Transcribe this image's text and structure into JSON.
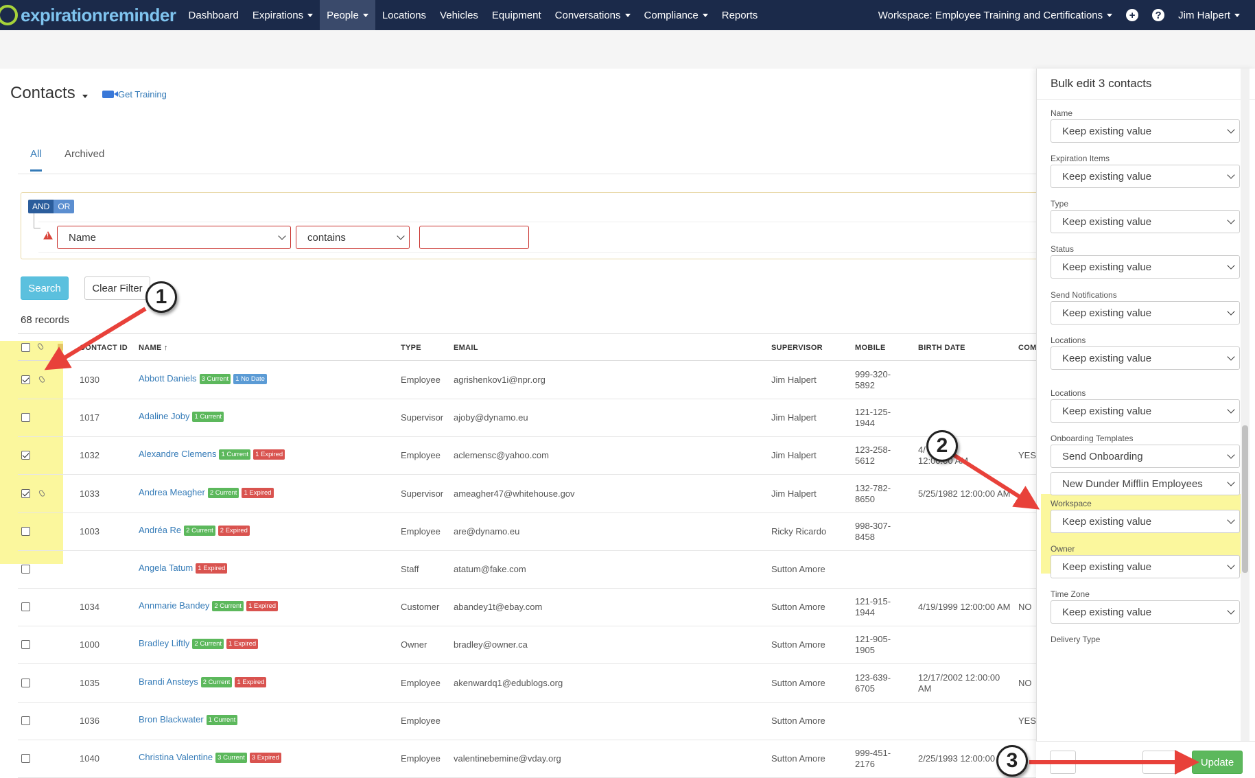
{
  "brand": {
    "name": "expirationreminder"
  },
  "nav": {
    "items": [
      {
        "label": "Dashboard",
        "dropdown": false
      },
      {
        "label": "Expirations",
        "dropdown": true
      },
      {
        "label": "People",
        "dropdown": true,
        "active": true
      },
      {
        "label": "Locations",
        "dropdown": false
      },
      {
        "label": "Vehicles",
        "dropdown": false
      },
      {
        "label": "Equipment",
        "dropdown": false
      },
      {
        "label": "Conversations",
        "dropdown": true
      },
      {
        "label": "Compliance",
        "dropdown": true
      },
      {
        "label": "Reports",
        "dropdown": false
      }
    ],
    "workspace": "Workspace: Employee Training and Certifications",
    "plus_icon": "+",
    "help_icon": "?",
    "user": "Jim Halpert"
  },
  "page": {
    "title": "Contacts",
    "training_label": "Get Training",
    "tabs": [
      "All",
      "Archived"
    ]
  },
  "filter": {
    "and_label": "AND",
    "or_label": "OR",
    "field": "Name",
    "operator": "contains",
    "value": ""
  },
  "actions": {
    "search": "Search",
    "clear": "Clear Filter"
  },
  "records": "68 records",
  "table": {
    "headers": {
      "contact_id": "CONTACT ID",
      "name": "NAME ↑",
      "type": "TYPE",
      "email": "EMAIL",
      "supervisor": "SUPERVISOR",
      "mobile": "MOBILE",
      "birth_date": "BIRTH DATE",
      "com": "COM"
    },
    "rows": [
      {
        "checked": true,
        "clip": true,
        "id": "1030",
        "name": "Abbott Daniels",
        "badges": [
          {
            "text": "3 Current",
            "kind": "current"
          },
          {
            "text": "1 No Date",
            "kind": "nodate"
          }
        ],
        "type": "Employee",
        "email": "agrishenkov1i@npr.org",
        "supervisor": "Jim Halpert",
        "mobile": [
          "999-320-",
          "5892"
        ],
        "birth": [],
        "com": ""
      },
      {
        "checked": false,
        "clip": false,
        "id": "1017",
        "name": "Adaline Joby",
        "badges": [
          {
            "text": "1 Current",
            "kind": "current"
          }
        ],
        "type": "Supervisor",
        "email": "ajoby@dynamo.eu",
        "supervisor": "Jim Halpert",
        "mobile": [
          "121-125-",
          "1944"
        ],
        "birth": [],
        "com": ""
      },
      {
        "checked": true,
        "clip": false,
        "id": "1032",
        "name": "Alexandre Clemens",
        "badges": [
          {
            "text": "1 Current",
            "kind": "current"
          },
          {
            "text": "1 Expired",
            "kind": "expired"
          }
        ],
        "type": "Employee",
        "email": "aclemensc@yahoo.com",
        "supervisor": "Jim Halpert",
        "mobile": [
          "123-258-",
          "5612"
        ],
        "birth": [
          "4/",
          "12:00:00 AM"
        ],
        "com": "YES"
      },
      {
        "checked": true,
        "clip": true,
        "id": "1033",
        "name": "Andrea Meagher",
        "badges": [
          {
            "text": "2 Current",
            "kind": "current"
          },
          {
            "text": "1 Expired",
            "kind": "expired"
          }
        ],
        "type": "Supervisor",
        "email": "ameagher47@whitehouse.gov",
        "supervisor": "Jim Halpert",
        "mobile": [
          "132-782-",
          "8650"
        ],
        "birth": [
          "5/25/1982 12:00:00 AM"
        ],
        "com": ""
      },
      {
        "checked": false,
        "clip": false,
        "id": "1003",
        "name": "Andréa Re",
        "badges": [
          {
            "text": "2 Current",
            "kind": "current"
          },
          {
            "text": "2 Expired",
            "kind": "expired"
          }
        ],
        "type": "Employee",
        "email": "are@dynamo.eu",
        "supervisor": "Ricky Ricardo",
        "mobile": [
          "998-307-",
          "8458"
        ],
        "birth": [],
        "com": ""
      },
      {
        "checked": false,
        "clip": false,
        "id": "",
        "name": "Angela Tatum",
        "badges": [
          {
            "text": "1 Expired",
            "kind": "expired"
          }
        ],
        "type": "Staff",
        "email": "atatum@fake.com",
        "supervisor": "Sutton Amore",
        "mobile": [],
        "birth": [],
        "com": ""
      },
      {
        "checked": false,
        "clip": false,
        "id": "1034",
        "name": "Annmarie Bandey",
        "badges": [
          {
            "text": "2 Current",
            "kind": "current"
          },
          {
            "text": "1 Expired",
            "kind": "expired"
          }
        ],
        "type": "Customer",
        "email": "abandey1t@ebay.com",
        "supervisor": "Sutton Amore",
        "mobile": [
          "121-915-",
          "1944"
        ],
        "birth": [
          "4/19/1999 12:00:00 AM"
        ],
        "com": "NO"
      },
      {
        "checked": false,
        "clip": false,
        "id": "1000",
        "name": "Bradley Liftly",
        "badges": [
          {
            "text": "2 Current",
            "kind": "current"
          },
          {
            "text": "1 Expired",
            "kind": "expired"
          }
        ],
        "type": "Owner",
        "email": "bradley@owner.ca",
        "supervisor": "Sutton Amore",
        "mobile": [
          "121-905-",
          "1905"
        ],
        "birth": [],
        "com": ""
      },
      {
        "checked": false,
        "clip": false,
        "id": "1035",
        "name": "Brandi Ansteys",
        "badges": [
          {
            "text": "2 Current",
            "kind": "current"
          },
          {
            "text": "1 Expired",
            "kind": "expired"
          }
        ],
        "type": "Employee",
        "email": "akenwardq1@edublogs.org",
        "supervisor": "Sutton Amore",
        "mobile": [
          "123-639-",
          "6705"
        ],
        "birth": [
          "12/17/2002 12:00:00",
          "AM"
        ],
        "com": "NO"
      },
      {
        "checked": false,
        "clip": false,
        "id": "1036",
        "name": "Bron Blackwater",
        "badges": [
          {
            "text": "1 Current",
            "kind": "current"
          }
        ],
        "type": "Employee",
        "email": "",
        "supervisor": "Sutton Amore",
        "mobile": [],
        "birth": [],
        "com": "YES"
      },
      {
        "checked": false,
        "clip": false,
        "id": "1040",
        "name": "Christina Valentine",
        "badges": [
          {
            "text": "3 Current",
            "kind": "current"
          },
          {
            "text": "3 Expired",
            "kind": "expired"
          }
        ],
        "type": "Employee",
        "email": "valentinebemine@vday.org",
        "supervisor": "Sutton Amore",
        "mobile": [
          "999-451-",
          "2176"
        ],
        "birth": [
          "2/25/1993 12:00:00 AM"
        ],
        "com": ""
      }
    ]
  },
  "panel": {
    "title": "Bulk edit 3 contacts",
    "fields": [
      {
        "label": "Name",
        "value": "Keep existing value"
      },
      {
        "label": "Expiration Items",
        "value": "Keep existing value"
      },
      {
        "label": "Type",
        "value": "Keep existing value"
      },
      {
        "label": "Status",
        "value": "Keep existing value"
      },
      {
        "label": "Send Notifications",
        "value": "Keep existing value"
      },
      {
        "label": "Locations",
        "value": "Keep existing value"
      },
      {
        "label": "Locations",
        "value": "Keep existing value"
      },
      {
        "label": "Onboarding Templates",
        "value": "Send Onboarding",
        "value2": "New Dunder Mifflin Employees"
      },
      {
        "label": "Workspace",
        "value": "Keep existing value"
      },
      {
        "label": "Owner",
        "value": "Keep existing value"
      },
      {
        "label": "Time Zone",
        "value": "Keep existing value"
      },
      {
        "label": "Delivery Type",
        "value": ""
      }
    ],
    "update_label": "Update"
  },
  "annotations": {
    "step1": "1",
    "step2": "2",
    "step3": "3",
    "arrow_color": "#e8413a",
    "highlight_color": "#fbf79d"
  }
}
